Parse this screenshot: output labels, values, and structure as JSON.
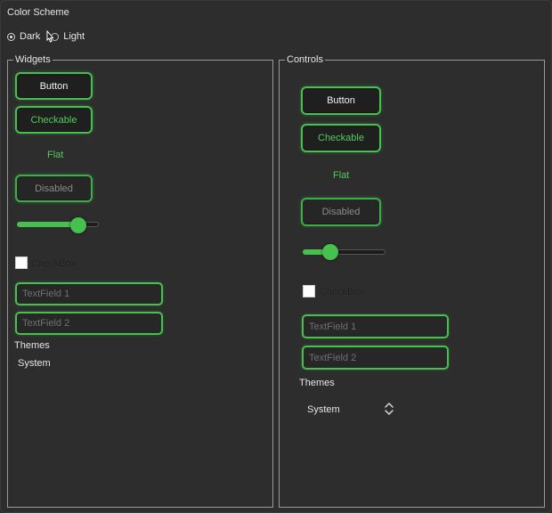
{
  "color_scheme": {
    "title": "Color Scheme",
    "options": [
      {
        "label": "Dark",
        "checked": true
      },
      {
        "label": "Light",
        "checked": false
      }
    ]
  },
  "widgets": {
    "title": "Widgets",
    "button": "Button",
    "checkable": "Checkable",
    "flat": "Flat",
    "disabled": "Disabled",
    "slider_value": 0.75,
    "checkbox": "CheckBox",
    "textfield1_placeholder": "TextField 1",
    "textfield2_placeholder": "TextField 2",
    "themes_label": "Themes",
    "themes_value": "System"
  },
  "controls": {
    "title": "Controls",
    "button": "Button",
    "checkable": "Checkable",
    "flat": "Flat",
    "disabled": "Disabled",
    "slider_value": 0.33,
    "checkbox": "CheckBox",
    "textfield1_placeholder": "TextField 1",
    "textfield2_placeholder": "TextField 2",
    "themes_label": "Themes",
    "themes_value": "System"
  },
  "colors": {
    "accent": "#46c04f",
    "background": "#2d2d2d"
  },
  "icons": {
    "cursor": "mouse-pointer-icon",
    "stepper": "up-down-chevron-icon"
  }
}
